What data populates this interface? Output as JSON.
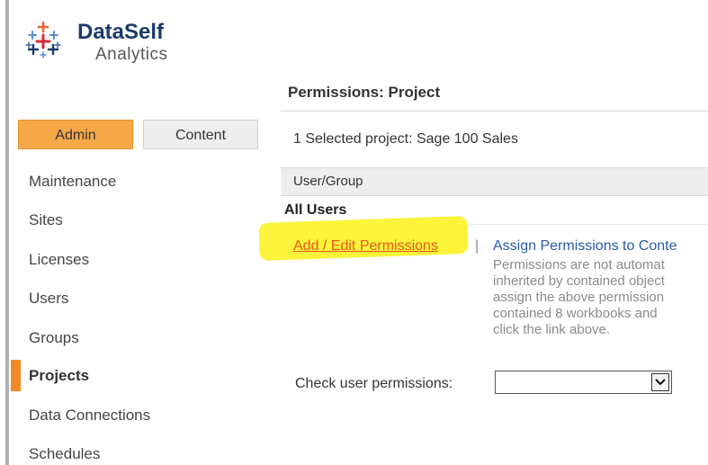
{
  "brand": {
    "name": "DataSelf",
    "subtitle": "Analytics"
  },
  "page": {
    "title": "Permissions: Project"
  },
  "tabs": [
    {
      "label": "Admin"
    },
    {
      "label": "Content"
    }
  ],
  "nav": {
    "items": [
      {
        "label": "Maintenance"
      },
      {
        "label": "Sites"
      },
      {
        "label": "Licenses"
      },
      {
        "label": "Users"
      },
      {
        "label": "Groups"
      },
      {
        "label": "Projects"
      },
      {
        "label": "Data Connections"
      },
      {
        "label": "Schedules"
      }
    ],
    "active_item": "Projects"
  },
  "content": {
    "selected_text": "1 Selected project:  Sage 100 Sales",
    "grid_header": "User/Group",
    "row_title": "All Users",
    "edit_link": "Add / Edit Permissions",
    "separator": "|",
    "assign_link": "Assign Permissions to Conte",
    "assign_desc": [
      "Permissions are not automat",
      "inherited by contained object",
      "assign the above permission",
      "contained 8 workbooks and",
      "click the link above."
    ],
    "check_label": "Check user permissions:",
    "check_select_value": ""
  },
  "colors": {
    "admin_tab": "#f7a94a",
    "active_marker": "#f08a24",
    "highlight": "#fbf43a",
    "link_orange": "#e8581c",
    "link_blue": "#2a5aa6"
  }
}
